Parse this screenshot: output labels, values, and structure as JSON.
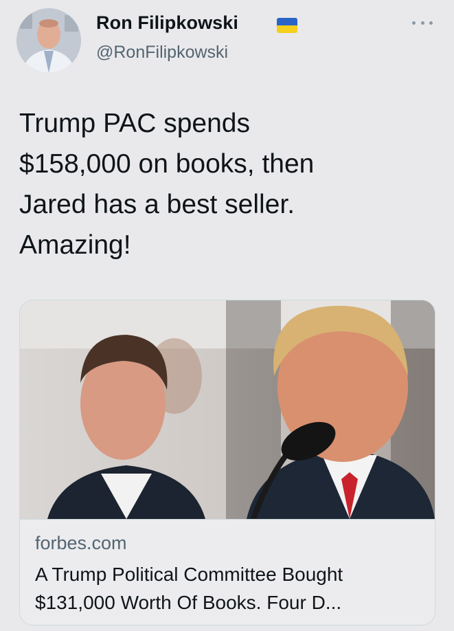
{
  "author": {
    "name": "Ron Filipkowski",
    "handle": "@RonFilipkowski",
    "flag_icon": "ukraine-flag",
    "flag_colors": [
      "#2a64c8",
      "#f4cf1d"
    ]
  },
  "tweet": {
    "text": "Trump PAC spends\n$158,000 on books, then\nJared has a best seller.\nAmazing!"
  },
  "card": {
    "domain": "forbes.com",
    "title": "A Trump Political Committee Bought $131,000 Worth Of Books. Four D..."
  },
  "icons": {
    "more": "more-horizontal-icon"
  }
}
